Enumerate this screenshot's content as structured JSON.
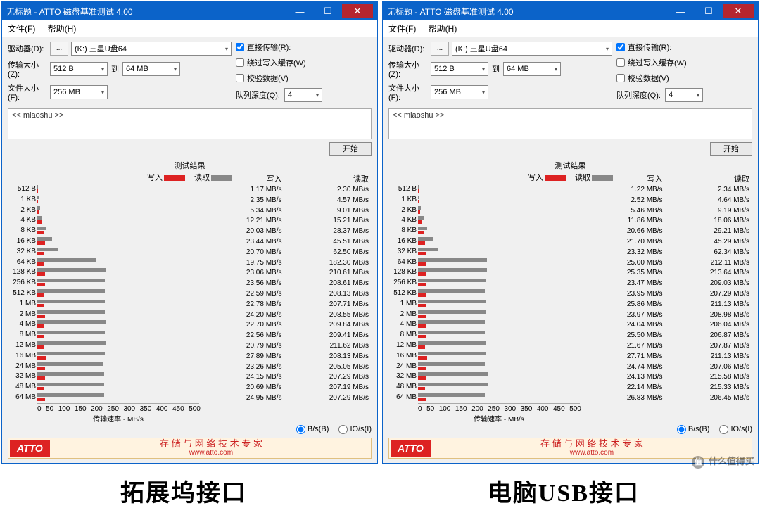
{
  "window_title": "无标题 - ATTO 磁盘基准测试 4.00",
  "menu": {
    "file": "文件(F)",
    "help": "帮助(H)"
  },
  "labels": {
    "drive": "驱动器(D):",
    "xfer_size": "传输大小(Z):",
    "file_size": "文件大小(F):",
    "to": "到",
    "direct_io": "直接传输(R):",
    "overlapped": "绕过写入缓存(W)",
    "verify": "校验数据(V)",
    "qdepth": "队列深度(Q):",
    "start": "开始",
    "results": "测试结果",
    "write": "写入",
    "read": "读取",
    "xrate": "传输速率 - MB/s",
    "bps": "B/s(B)",
    "ios": "IO/s(I)",
    "footer_main": "存 储 与 网 络 技 术 专 家",
    "footer_url": "www.atto.com",
    "atto": "ATTO"
  },
  "controls": {
    "drive_value": "(K:) 三星U盘64",
    "xfer_min": "512 B",
    "xfer_max": "64 MB",
    "file_size": "256 MB",
    "qdepth": "4",
    "desc": "<< miaoshu >>",
    "direct_io_checked": true
  },
  "x_ticks": [
    "0",
    "50",
    "100",
    "150",
    "200",
    "250",
    "300",
    "350",
    "400",
    "450",
    "500"
  ],
  "captions": {
    "left": "拓展坞接口",
    "right": "电脑USB接口"
  },
  "watermark": "什么值得买",
  "chart_data": [
    {
      "type": "bar",
      "title": "拓展坞接口",
      "categories": [
        "512 B",
        "1 KB",
        "2 KB",
        "4 KB",
        "8 KB",
        "16 KB",
        "32 KB",
        "64 KB",
        "128 KB",
        "256 KB",
        "512 KB",
        "1 MB",
        "2 MB",
        "4 MB",
        "8 MB",
        "12 MB",
        "16 MB",
        "24 MB",
        "32 MB",
        "48 MB",
        "64 MB"
      ],
      "series": [
        {
          "name": "写入",
          "unit": "MB/s",
          "values": [
            1.17,
            2.35,
            5.34,
            12.21,
            20.03,
            23.44,
            20.7,
            19.75,
            23.06,
            23.56,
            22.59,
            22.78,
            24.2,
            22.7,
            22.56,
            20.79,
            27.89,
            23.26,
            24.15,
            20.69,
            24.95
          ]
        },
        {
          "name": "读取",
          "unit": "MB/s",
          "values": [
            2.3,
            4.57,
            9.01,
            15.21,
            28.37,
            45.51,
            62.5,
            182.3,
            210.61,
            208.61,
            208.13,
            207.71,
            208.55,
            209.84,
            209.41,
            211.62,
            208.13,
            205.05,
            207.29,
            207.19,
            207.29
          ]
        }
      ],
      "xlabel": "传输速率 - MB/s",
      "xlim": [
        0,
        500
      ]
    },
    {
      "type": "bar",
      "title": "电脑USB接口",
      "categories": [
        "512 B",
        "1 KB",
        "2 KB",
        "4 KB",
        "8 KB",
        "16 KB",
        "32 KB",
        "64 KB",
        "128 KB",
        "256 KB",
        "512 KB",
        "1 MB",
        "2 MB",
        "4 MB",
        "8 MB",
        "12 MB",
        "16 MB",
        "24 MB",
        "32 MB",
        "48 MB",
        "64 MB"
      ],
      "series": [
        {
          "name": "写入",
          "unit": "MB/s",
          "values": [
            1.22,
            2.52,
            5.46,
            11.86,
            20.66,
            21.7,
            23.32,
            25.0,
            25.35,
            23.47,
            23.95,
            25.86,
            23.97,
            24.04,
            25.5,
            21.67,
            27.71,
            24.74,
            24.13,
            22.14,
            26.83
          ]
        },
        {
          "name": "读取",
          "unit": "MB/s",
          "values": [
            2.34,
            4.64,
            9.19,
            18.06,
            29.21,
            45.29,
            62.34,
            212.11,
            213.64,
            209.03,
            207.29,
            211.13,
            208.98,
            206.04,
            206.87,
            207.87,
            211.13,
            207.06,
            215.58,
            215.33,
            206.45
          ]
        }
      ],
      "xlabel": "传输速率 - MB/s",
      "xlim": [
        0,
        500
      ]
    }
  ]
}
